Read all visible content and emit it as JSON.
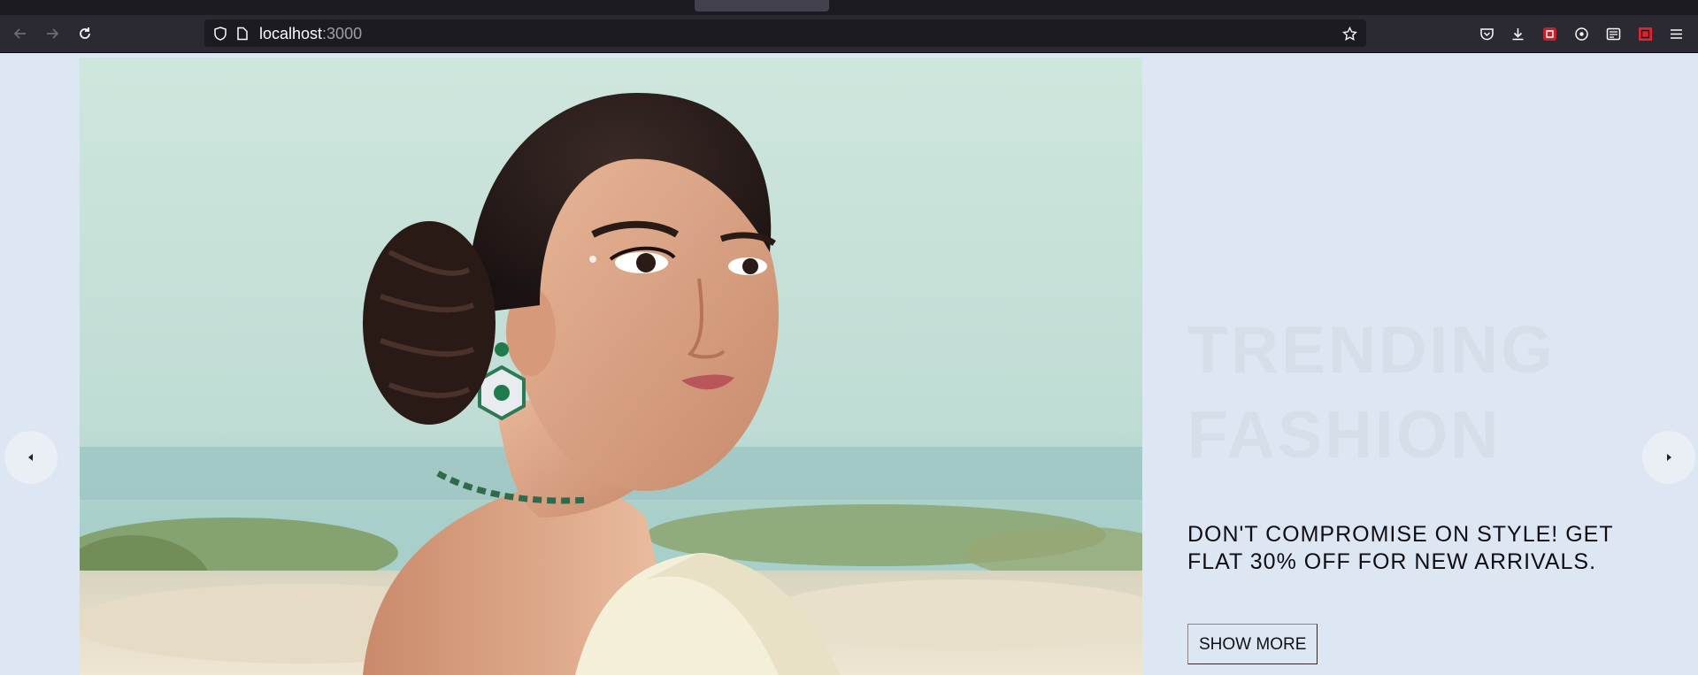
{
  "browser": {
    "url_host": "localhost",
    "url_port": ":3000"
  },
  "hero": {
    "title_line1": "TRENDING",
    "title_line2": "FASHION",
    "description": "DON'T COMPROMISE ON STYLE! GET FLAT 30% OFF FOR NEW ARRIVALS.",
    "button_label": "SHOW MORE",
    "image_icon": "fashion-model-photo"
  },
  "colors": {
    "page_background": "#dde6f3",
    "title_color": "#d6deea",
    "chrome_toolbar": "#2b2a33"
  }
}
